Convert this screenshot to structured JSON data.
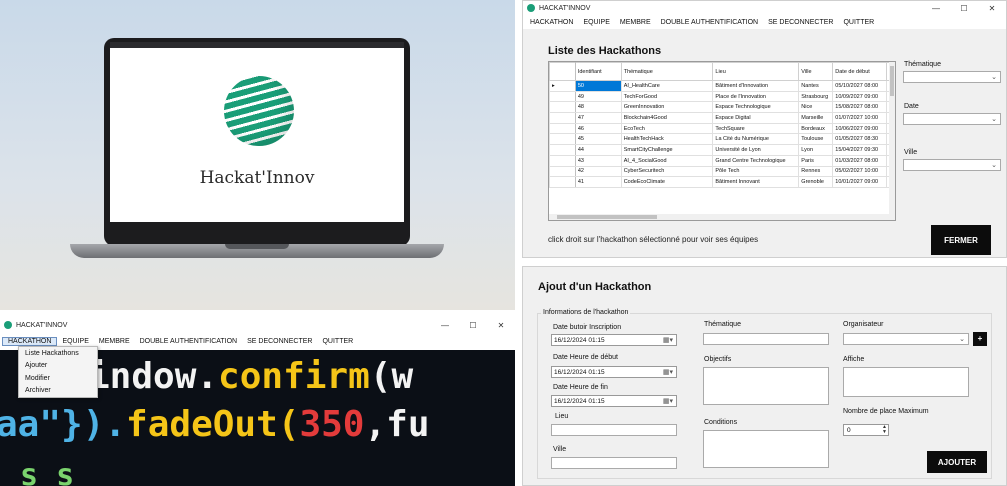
{
  "laptop": {
    "brand": "Hackat'Innov"
  },
  "app": {
    "title": "HACKAT'INNOV",
    "ctrl_min": "—",
    "ctrl_max": "☐",
    "ctrl_close": "✕"
  },
  "menu": [
    "HACKATHON",
    "EQUIPE",
    "MEMBRE",
    "DOUBLE AUTHENTIFICATION",
    "SE DECONNECTER",
    "QUITTER"
  ],
  "list_window": {
    "heading": "Liste des Hackathons",
    "columns": [
      "Identifiant",
      "Thématique",
      "Lieu",
      "Ville",
      "Date de début"
    ],
    "rows": [
      [
        "50",
        "AI_HealthCare",
        "Bâtiment d'Innovation",
        "Nantes",
        "05/10/2027 08:00"
      ],
      [
        "49",
        "TechForGood",
        "Place de l'Innovation",
        "Strasbourg",
        "10/09/2027 09:00"
      ],
      [
        "48",
        "GreenInnovation",
        "Espace Technologique",
        "Nice",
        "15/08/2027 08:00"
      ],
      [
        "47",
        "Blockchain4Good",
        "Espace Digital",
        "Marseille",
        "01/07/2027 10:00"
      ],
      [
        "46",
        "EcoTech",
        "TechSquare",
        "Bordeaux",
        "10/06/2027 09:00"
      ],
      [
        "45",
        "HealthTechHack",
        "La Cité du Numérique",
        "Toulouse",
        "01/05/2027 08:30"
      ],
      [
        "44",
        "SmartCityChallenge",
        "Université de Lyon",
        "Lyon",
        "15/04/2027 09:30"
      ],
      [
        "43",
        "AI_4_SocialGood",
        "Grand Centre Technologique",
        "Paris",
        "01/03/2027 08:00"
      ],
      [
        "42",
        "CyberSecuritech",
        "Pôle Tech",
        "Rennes",
        "05/02/2027 10:00"
      ],
      [
        "41",
        "CodeEcoClimate",
        "Bâtiment Innovant",
        "Grenoble",
        "10/01/2027 09:00"
      ]
    ],
    "filters": {
      "thematique": "Thématique",
      "date": "Date",
      "ville": "Ville"
    },
    "hint": "click droit sur l'hackathon sélectionné pour voir ses équipes",
    "close_button": "FERMER",
    "row_marker": "▸",
    "cell_ellipsis": "c"
  },
  "dropdown": [
    "Liste Hackathons",
    "Ajouter",
    "Modifier",
    "Archiver"
  ],
  "code_lines": [
    {
      "text": "indow.confirm(w",
      "color": "#f3f3f3"
    },
    {
      "text": "aa\"}).fadeOut(350,fu",
      "color": "#4fb3e6"
    },
    {
      "text": "  s   s",
      "color": "#7ad36d"
    }
  ],
  "code_highlights": {
    "confirm": "#f5c518",
    "350": "#e33b3b"
  },
  "form": {
    "heading": "Ajout d'un Hackathon",
    "group": "Informations de l'hackathon",
    "labels": {
      "date_butoir": "Date butoir Inscription",
      "date_debut": "Date Heure de début",
      "date_fin": "Date Heure de fin",
      "lieu": "Lieu",
      "ville": "Ville",
      "thematique": "Thématique",
      "objectifs": "Objectifs",
      "conditions": "Conditions",
      "organisateur": "Organisateur",
      "affiche": "Affiche",
      "nb_places": "Nombre de place Maximum"
    },
    "date_butoir_value": "16/12/2024 01:15",
    "date_debut_value": "16/12/2024 01:15",
    "date_fin_value": "16/12/2024 01:15",
    "nb_places_value": "0",
    "add_button": "AJOUTER",
    "plus_button": "+"
  }
}
